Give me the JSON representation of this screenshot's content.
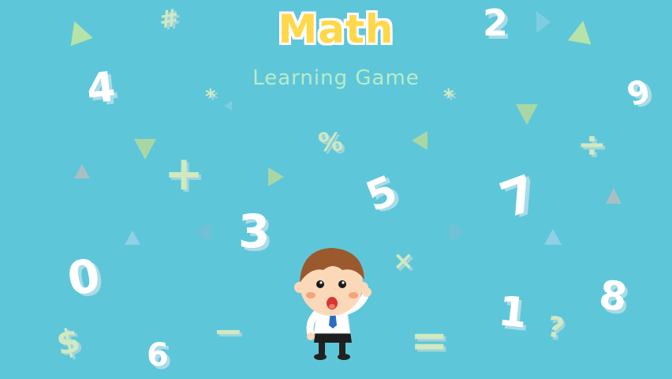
{
  "title": "Math",
  "subtitle": "Learning Game",
  "symbols": {
    "n4": "4",
    "n2": "2",
    "n9": "9",
    "n3": "3",
    "n5": "5",
    "n7": "7",
    "n0": "0",
    "n8": "8",
    "n1": "1",
    "n6": "6",
    "hash": "#",
    "star1": "*",
    "star2": "*",
    "percent": "%",
    "plus": "+",
    "divide": "÷",
    "times": "×",
    "minus": "−",
    "equals": "=",
    "question": "?",
    "dollar": "$"
  },
  "colors": {
    "background": "#5ec6d9",
    "title": "#ffd84a",
    "subtitle": "#b9ecc9",
    "triangle_green": "#b6e3a8",
    "triangle_light": "#8fd0e6"
  }
}
